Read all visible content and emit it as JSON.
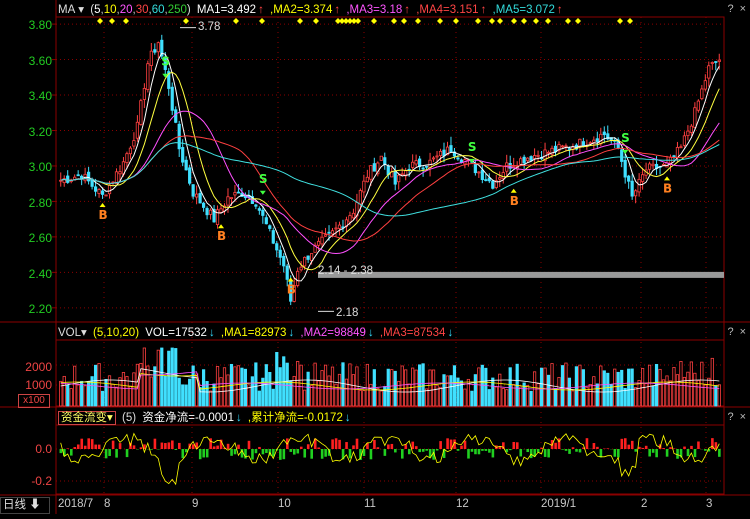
{
  "main_header": {
    "indicator": "MA",
    "params_open": "(",
    "params": [
      "5",
      "10",
      "20",
      "30",
      "60",
      "250"
    ],
    "params_close": ")",
    "ma1": "MA1=3.492",
    "ma2": ",MA2=3.374",
    "ma3": ",MA3=3.18",
    "ma4": ",MA4=3.151",
    "ma5": ",MA5=3.072"
  },
  "vol_header": {
    "indicator": "VOL",
    "params": "(5,10,20)",
    "vol": "VOL=17532",
    "ma1": ",MA1=82973",
    "ma2": ",MA2=98849",
    "ma3": ",MA3=87534"
  },
  "fund_header": {
    "indicator": "资金流变",
    "param": "(5)",
    "net": "资金净流=-0.0001",
    "cum": ",累计净流=-0.0172"
  },
  "controls": {
    "help": "?",
    "close": "×"
  },
  "arrow_up": "↑",
  "arrow_down": "↓",
  "price_axis": [
    "3.80",
    "3.60",
    "3.40",
    "3.20",
    "3.00",
    "2.80",
    "2.60",
    "2.40",
    "2.20"
  ],
  "vol_axis": [
    "2000",
    "1000"
  ],
  "vol_unit": "x100",
  "fund_axis": [
    "0.0",
    "-0.2"
  ],
  "x_axis": [
    "2018/7",
    "8",
    "9",
    "10",
    "11",
    "12",
    "2019/1",
    "2",
    "3"
  ],
  "period_label": "日线",
  "annotations": {
    "high": "3.78",
    "low": "2.18",
    "range": "2.14 - 2.38"
  },
  "signals": [
    {
      "label": "B",
      "date_index": 12,
      "price": 2.78
    },
    {
      "label": "S",
      "date_index": 30,
      "price": 3.52
    },
    {
      "label": "B",
      "date_index": 46,
      "price": 2.66
    },
    {
      "label": "S",
      "date_index": 58,
      "price": 2.86
    },
    {
      "label": "B",
      "date_index": 66,
      "price": 2.36
    },
    {
      "label": "S",
      "date_index": 118,
      "price": 3.04
    },
    {
      "label": "B",
      "date_index": 130,
      "price": 2.86
    },
    {
      "label": "S",
      "date_index": 162,
      "price": 3.09
    },
    {
      "label": "B",
      "date_index": 174,
      "price": 2.93
    }
  ],
  "colors": {
    "up": "#ff4040",
    "down": "#40e0ff",
    "ma1": "#ffffff",
    "ma2": "#ffff40",
    "ma3": "#ff50ff",
    "ma4": "#ff4040",
    "ma5": "#40e0e0",
    "grid": "#8b0000",
    "axis_text_price": "#20d020",
    "axis_text_vol": "#ff4040"
  },
  "chart_data": {
    "type": "candlestick",
    "series_note": "daily OHLC, roughly Jul 2018 - Mar 2019",
    "keypoints": [
      [
        0,
        2.92
      ],
      [
        6,
        2.95
      ],
      [
        12,
        2.83
      ],
      [
        18,
        3.02
      ],
      [
        22,
        3.22
      ],
      [
        25,
        3.58
      ],
      [
        28,
        3.7
      ],
      [
        31,
        3.45
      ],
      [
        34,
        3.1
      ],
      [
        38,
        2.85
      ],
      [
        44,
        2.7
      ],
      [
        48,
        2.82
      ],
      [
        52,
        2.85
      ],
      [
        56,
        2.8
      ],
      [
        60,
        2.62
      ],
      [
        64,
        2.44
      ],
      [
        66,
        2.24
      ],
      [
        68,
        2.42
      ],
      [
        72,
        2.52
      ],
      [
        78,
        2.62
      ],
      [
        84,
        2.75
      ],
      [
        88,
        2.95
      ],
      [
        92,
        3.05
      ],
      [
        96,
        2.9
      ],
      [
        100,
        3.0
      ],
      [
        106,
        3.02
      ],
      [
        112,
        3.1
      ],
      [
        118,
        3.0
      ],
      [
        124,
        2.9
      ],
      [
        128,
        3.0
      ],
      [
        134,
        3.05
      ],
      [
        140,
        3.08
      ],
      [
        148,
        3.12
      ],
      [
        156,
        3.18
      ],
      [
        160,
        3.1
      ],
      [
        164,
        2.82
      ],
      [
        168,
        2.98
      ],
      [
        174,
        3.0
      ],
      [
        178,
        3.1
      ],
      [
        182,
        3.3
      ],
      [
        186,
        3.55
      ],
      [
        189,
        3.6
      ]
    ],
    "price_range": [
      2.12,
      3.84
    ]
  }
}
